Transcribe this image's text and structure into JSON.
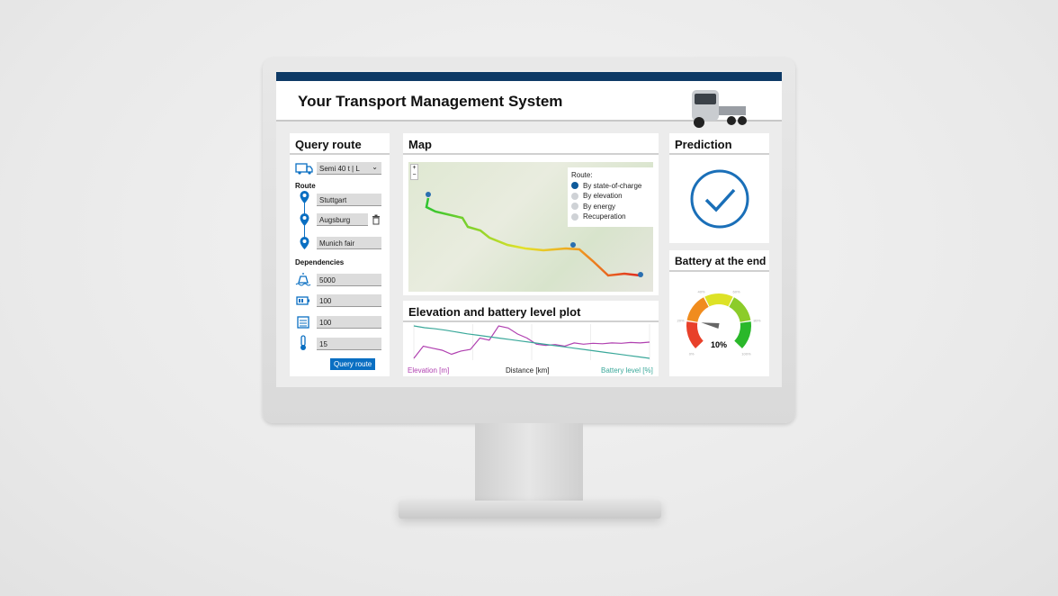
{
  "app": {
    "title": "Your Transport Management System"
  },
  "colors": {
    "brand": "#0e3a66",
    "accent": "#0a6fc2",
    "elevation": "#b040b0",
    "battery": "#3aa89a"
  },
  "query": {
    "title": "Query route",
    "vehicle": "Semi 40 t | L",
    "route_label": "Route",
    "stops": [
      "Stuttgart",
      "Augsburg",
      "Munich fair"
    ],
    "dependencies_label": "Dependencies",
    "dependencies": [
      {
        "icon": "weight-icon",
        "value": "5000"
      },
      {
        "icon": "battery-icon",
        "value": "100"
      },
      {
        "icon": "calendar-icon",
        "value": "100"
      },
      {
        "icon": "thermometer-icon",
        "value": "15"
      }
    ],
    "button": "Query route"
  },
  "map": {
    "title": "Map",
    "legend_title": "Route:",
    "options": [
      {
        "label": "By state-of-charge",
        "selected": true
      },
      {
        "label": "By elevation",
        "selected": false
      },
      {
        "label": "By energy",
        "selected": false
      },
      {
        "label": "Recuperation",
        "selected": false
      }
    ],
    "zoom_in": "+",
    "zoom_out": "−"
  },
  "plot": {
    "title": "Elevation and battery level plot",
    "left_label": "Elevation [m]",
    "x_label": "Distance [km]",
    "right_label": "Battery level [%]"
  },
  "chart_data": {
    "type": "line",
    "xlabel": "Distance [km]",
    "ylabel": "Elevation [m]",
    "y2label": "Battery level [%]",
    "series": [
      {
        "name": "Elevation [m]",
        "values": [
          10,
          40,
          35,
          30,
          20,
          28,
          32,
          60,
          55,
          90,
          85,
          70,
          60,
          45,
          42,
          44,
          40,
          48,
          45,
          47,
          46,
          48,
          47,
          49,
          48,
          50
        ]
      },
      {
        "name": "Battery level [%]",
        "values": [
          100,
          95,
          92,
          88,
          83,
          78,
          74,
          70,
          66,
          62,
          58,
          54,
          50,
          46,
          42,
          38,
          34,
          30,
          26,
          22,
          18,
          14,
          10
        ]
      }
    ]
  },
  "prediction": {
    "title": "Prediction",
    "status": "ok"
  },
  "battery": {
    "title": "Battery at the end",
    "value": "10%",
    "level": 10,
    "ticks": [
      "0%",
      "20%",
      "40%",
      "60%",
      "80%",
      "100%"
    ]
  }
}
